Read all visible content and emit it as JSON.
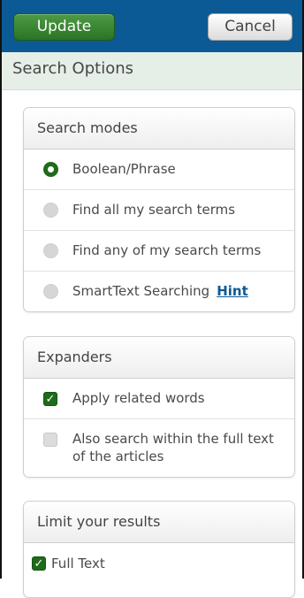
{
  "toolbar": {
    "update_label": "Update",
    "cancel_label": "Cancel"
  },
  "header": {
    "title": "Search Options"
  },
  "search_modes": {
    "title": "Search modes",
    "options": [
      {
        "label": "Boolean/Phrase",
        "selected": true
      },
      {
        "label": "Find all my search terms",
        "selected": false
      },
      {
        "label": "Find any of my search terms",
        "selected": false
      },
      {
        "label": "SmartText Searching",
        "selected": false,
        "hint": "Hint"
      }
    ]
  },
  "expanders": {
    "title": "Expanders",
    "options": [
      {
        "label": "Apply related words",
        "checked": true
      },
      {
        "label_line1": "Also search within the full text",
        "label_line2": "of the articles",
        "checked": false
      }
    ]
  },
  "limits": {
    "title": "Limit your results",
    "options": [
      {
        "label": "Full Text",
        "checked": true
      }
    ]
  },
  "colors": {
    "header_blue": "#0b5a96",
    "accent_green": "#1e6b1a",
    "subheader_bg": "#e6eee8"
  }
}
